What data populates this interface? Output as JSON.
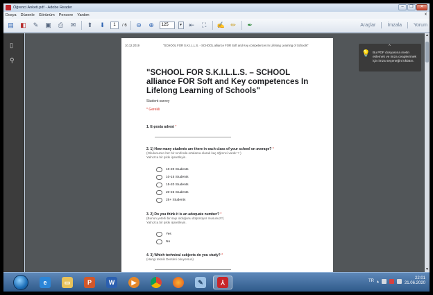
{
  "window": {
    "title": "Öğrenci Anketi.pdf - Adobe Reader",
    "controls": {
      "minimize": "–",
      "maximize": "❐",
      "close": "✕"
    }
  },
  "menu": {
    "items": [
      "Dosya",
      "Düzenle",
      "Görünüm",
      "Pencere",
      "Yardım"
    ],
    "close_glyph": "x"
  },
  "toolbar": {
    "page_current": "1",
    "page_total": "/ 6",
    "zoom": "125",
    "links": [
      "Araçlar",
      "İmzala",
      "Yorum"
    ]
  },
  "document": {
    "header_date": "10.12.2019",
    "header_title": "\"SCHOOL FOR S.K.I.L.L.S. - SCHOOL alliance FOR Soft and Key competences In Lifelong Learning of Schools\"",
    "title": "\"SCHOOL FOR S.K.I.L.L.S. – SCHOOL alliance FOR Soft and Key competences In Lifelong Learning of Schools\"",
    "subtitle": "Student survey",
    "required_note": "* Gerekli",
    "questions": [
      {
        "label": "1. E-posta adresi",
        "req": " *"
      },
      {
        "label": "2. 1) How many students are there in each class of your school on average?",
        "req": " *",
        "hint1": "(Okulunuzun her bir sınıfında ortalama olarak kaç öğrenci vardır ? )",
        "hint2": "Yalnızca bir şıkkı işaretleyin.",
        "options": [
          "10-20 Students",
          "10-15 Students",
          "15-20 Students",
          "20-25 Students",
          "25+ Students"
        ]
      },
      {
        "label": "3. 2) Do you think it is an adequate number?",
        "req": " *",
        "hint1": "(Bunun yeterli bir sayı olduğunu düşünüyor musunuz?)",
        "hint2": "Yalnızca bir şıkkı işaretleyin.",
        "options": [
          "Yes",
          "No"
        ]
      },
      {
        "label": "4. 3) Which technical subjects do you study?",
        "req": " *",
        "hint1": "(Hangi teknik Dersleri okuyorsun)"
      }
    ]
  },
  "tooltip": {
    "caret": "^",
    "text": "Bu PDF dosyasına metin eklemek ve imza ceaplerimek için imza seçeneğini tıklatın."
  },
  "taskbar": {
    "apps": [
      "internet-explorer",
      "file-explorer",
      "powerpoint",
      "word",
      "media-player",
      "chrome",
      "firefox",
      "notepad",
      "adobe-reader"
    ],
    "tray_lang": "TR",
    "clock_time": "22:01",
    "clock_date": "21.06.2020"
  },
  "colors": {
    "workspace": "#525659",
    "required": "#d93025",
    "taskbar": "#2f5a8a"
  }
}
